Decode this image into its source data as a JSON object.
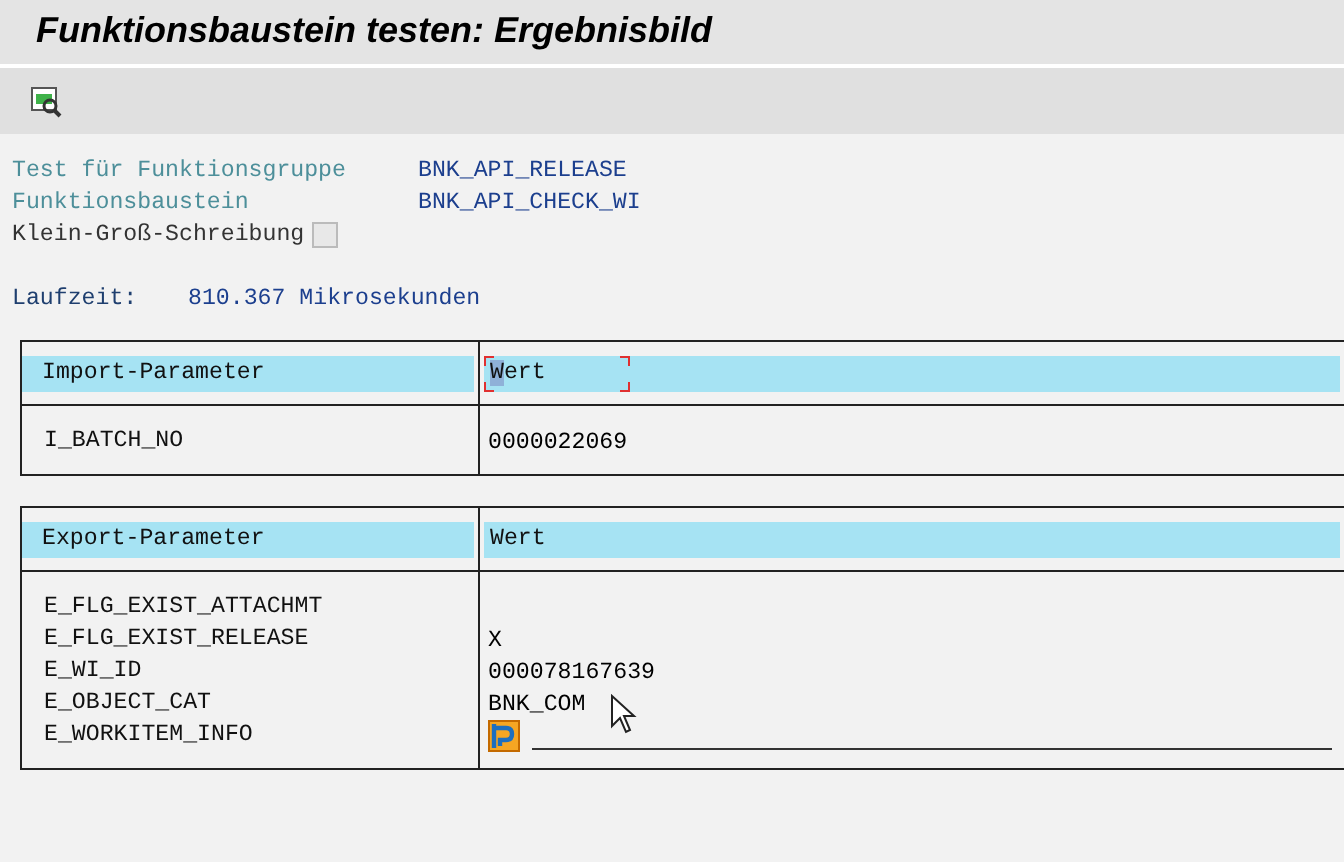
{
  "window": {
    "title": "Funktionsbaustein testen: Ergebnisbild"
  },
  "toolbar": {
    "buttons": [
      {
        "kind": "display"
      }
    ]
  },
  "header_fields": [
    {
      "label": "Test für Funktionsgruppe",
      "value": "BNK_API_RELEASE"
    },
    {
      "label": "Funktionsbaustein",
      "value": "BNK_API_CHECK_WI"
    }
  ],
  "case_sensitive": {
    "label": "Klein-Groß-Schreibung",
    "checked": false
  },
  "runtime": {
    "label": "Laufzeit:",
    "value": "810.367 Mikrosekunden"
  },
  "tables": [
    {
      "heading": "Import-Parameter",
      "value_heading": "Wert",
      "focused": true,
      "rows": [
        {
          "name": "I_BATCH_NO",
          "kind": "text",
          "value": "0000022069"
        }
      ]
    },
    {
      "heading": "Export-Parameter",
      "value_heading": "Wert",
      "focused": false,
      "rows": [
        {
          "name": "E_FLG_EXIST_ATTACHMT",
          "kind": "text",
          "value": ""
        },
        {
          "name": "E_FLG_EXIST_RELEASE",
          "kind": "text",
          "value": "X"
        },
        {
          "name": "E_WI_ID",
          "kind": "text",
          "value": "000078167639"
        },
        {
          "name": "E_OBJECT_CAT",
          "kind": "text",
          "value": "BNK_COM"
        },
        {
          "name": "E_WORKITEM_INFO",
          "kind": "structure"
        }
      ]
    }
  ]
}
